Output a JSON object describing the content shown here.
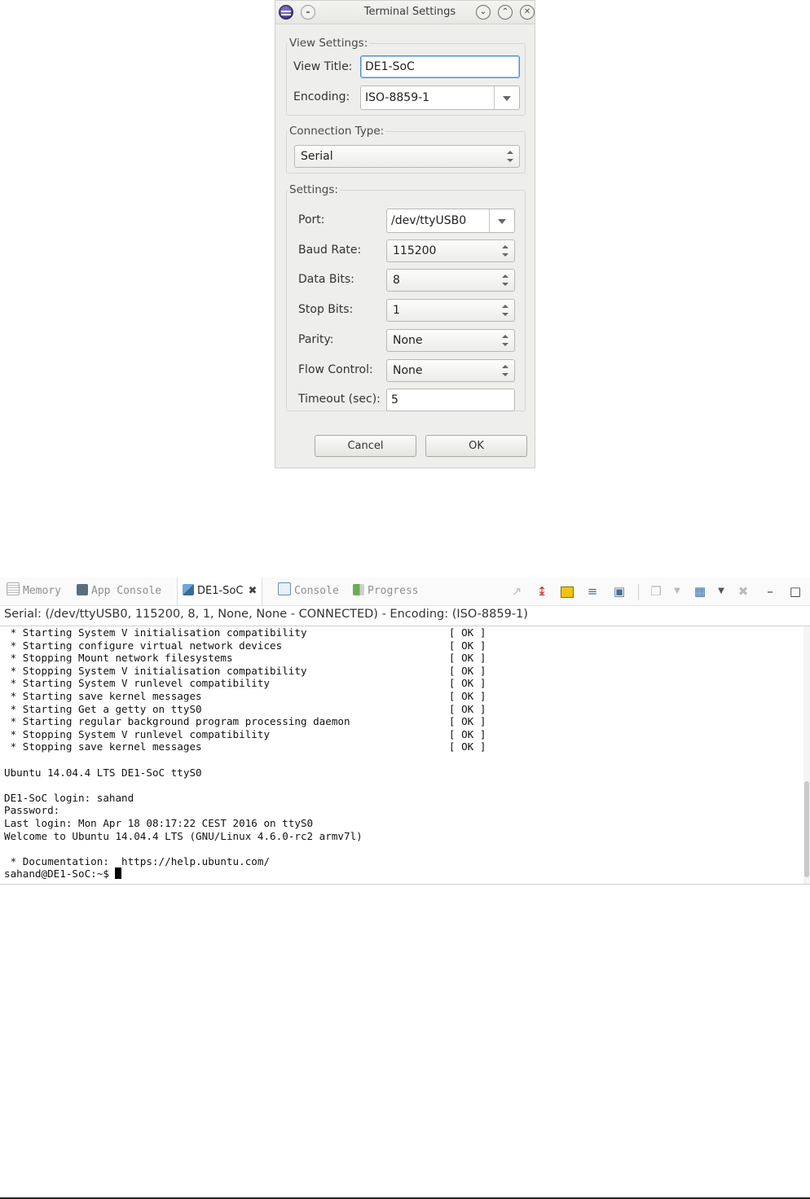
{
  "dialog": {
    "title": "Terminal Settings",
    "view_settings": {
      "legend": "View Settings:",
      "view_title_label": "View Title:",
      "view_title_value": "DE1-SoC",
      "encoding_label": "Encoding:",
      "encoding_value": "ISO-8859-1"
    },
    "connection_type": {
      "legend": "Connection Type:",
      "value": "Serial"
    },
    "settings": {
      "legend": "Settings:",
      "port_label": "Port:",
      "port_value": "/dev/ttyUSB0",
      "baud_label": "Baud Rate:",
      "baud_value": "115200",
      "data_bits_label": "Data Bits:",
      "data_bits_value": "8",
      "stop_bits_label": "Stop Bits:",
      "stop_bits_value": "1",
      "parity_label": "Parity:",
      "parity_value": "None",
      "flow_label": "Flow Control:",
      "flow_value": "None",
      "timeout_label": "Timeout (sec):",
      "timeout_value": "5"
    },
    "cancel_label": "Cancel",
    "ok_label": "OK"
  },
  "terminal": {
    "tabs": [
      {
        "label": "Memory"
      },
      {
        "label": "App Console"
      },
      {
        "label": "DE1-SoC"
      },
      {
        "label": "Console"
      },
      {
        "label": "Progress"
      }
    ],
    "status": "Serial: (/dev/ttyUSB0, 115200, 8, 1, None, None - CONNECTED) - Encoding: (ISO-8859-1)",
    "lines": [
      " * Starting System V initialisation compatibility                       [ OK ]",
      " * Starting configure virtual network devices                           [ OK ]",
      " * Stopping Mount network filesystems                                   [ OK ]",
      " * Stopping System V initialisation compatibility                       [ OK ]",
      " * Starting System V runlevel compatibility                             [ OK ]",
      " * Starting save kernel messages                                        [ OK ]",
      " * Starting Get a getty on ttyS0                                        [ OK ]",
      " * Starting regular background program processing daemon                [ OK ]",
      " * Stopping System V runlevel compatibility                             [ OK ]",
      " * Stopping save kernel messages                                        [ OK ]",
      "",
      "Ubuntu 14.04.4 LTS DE1-SoC ttyS0",
      "",
      "DE1-SoC login: sahand",
      "Password:",
      "Last login: Mon Apr 18 08:17:22 CEST 2016 on ttyS0",
      "Welcome to Ubuntu 14.04.4 LTS (GNU/Linux 4.6.0-rc2 armv7l)",
      "",
      " * Documentation:  https://help.ubuntu.com/"
    ],
    "prompt": "sahand@DE1-SoC:~$ "
  }
}
